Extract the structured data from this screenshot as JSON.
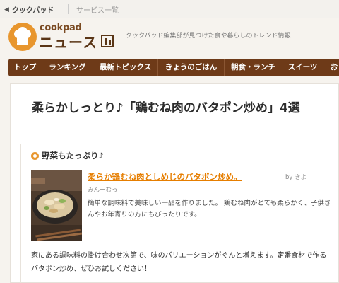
{
  "topbar": {
    "back_label": "クックパッド",
    "services_label": "サービス一覧"
  },
  "header": {
    "logo_small": "cookpad",
    "logo_big": "ニュース",
    "tagline": "クックパッド編集部が見つけた食や暮らしのトレンド情報"
  },
  "nav": {
    "items": [
      "トップ",
      "ランキング",
      "最新トピックス",
      "きょうのごはん",
      "朝食・ランチ",
      "スイーツ",
      "お"
    ]
  },
  "article": {
    "title": "柔らかしっとり♪「鶏むね肉のバタポン炒め」4選",
    "section_title": "野菜もたっぷり♪",
    "recipe_title": "柔らか鶏むね肉としめじのバタポン炒め。",
    "byline_prefix": "by きよ",
    "byline_name": "みんーむっ",
    "recipe_desc": "簡単な調味料で美味しい一品を作りました。 鶏むね肉がとても柔らかく、子供さんやお年寄りの方にもぴったりです。",
    "body": "家にある調味料の掛け合わせ次第で、味のバリエーションがぐんと増えます。定番食材で作るバタポン炒め、ぜひお試しください！"
  },
  "colors": {
    "brand_orange": "#e8962e",
    "nav_brown": "#6e3a18",
    "link_orange": "#e67e00"
  }
}
